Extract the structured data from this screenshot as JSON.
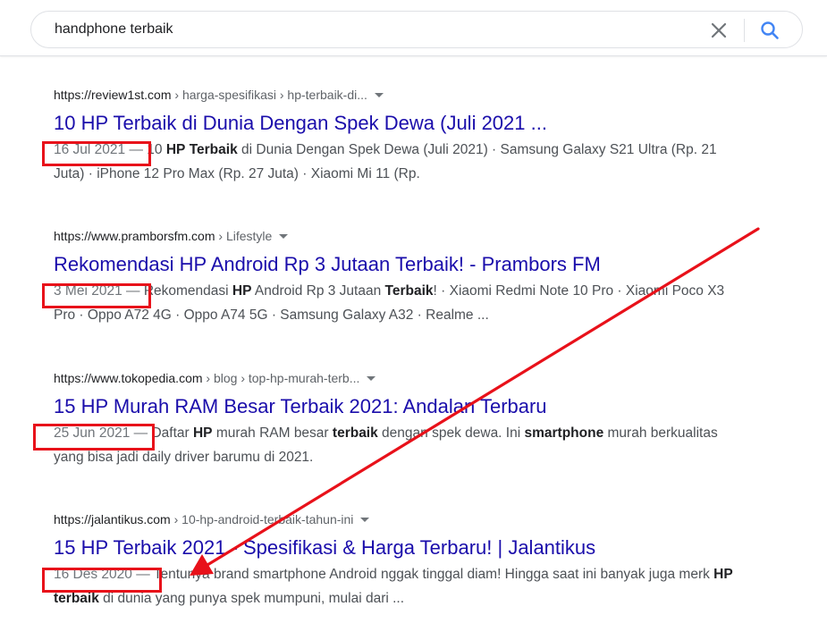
{
  "search": {
    "query": "handphone terbaik",
    "clear_icon": "close-icon",
    "search_icon": "search-icon"
  },
  "colors": {
    "link": "#1a0dab",
    "annotation": "#e8111a",
    "search_icon": "#4285f4"
  },
  "results": [
    {
      "domain": "https://review1st.com",
      "path": " › harga-spesifikasi › hp-terbaik-di...",
      "title": "10 HP Terbaik di Dunia Dengan Spek Dewa (Juli 2021 ...",
      "date": "16 Jul 2021",
      "dash": " — ",
      "snippet": [
        {
          "t": "10 ",
          "b": false
        },
        {
          "t": "HP",
          "b": true
        },
        {
          "t": " ",
          "b": false
        },
        {
          "t": "Terbaik",
          "b": true
        },
        {
          "t": " di Dunia Dengan Spek Dewa (Juli 2021) · Samsung Galaxy S21 Ultra (Rp. 21 Juta) · iPhone 12 Pro Max (Rp. 27 Juta) · Xiaomi Mi 11 (Rp.",
          "b": false
        }
      ]
    },
    {
      "domain": "https://www.pramborsfm.com",
      "path": " › Lifestyle",
      "title": "Rekomendasi HP Android Rp 3 Jutaan Terbaik! - Prambors FM",
      "date": "3 Mei 2021",
      "dash": " — ",
      "snippet": [
        {
          "t": "Rekomendasi ",
          "b": false
        },
        {
          "t": "HP",
          "b": true
        },
        {
          "t": " Android Rp 3 Jutaan ",
          "b": false
        },
        {
          "t": "Terbaik",
          "b": true
        },
        {
          "t": "! · Xiaomi Redmi Note 10 Pro · Xiaomi Poco X3 Pro · Oppo A72 4G · Oppo A74 5G · Samsung Galaxy A32 · Realme ...",
          "b": false
        }
      ]
    },
    {
      "domain": "https://www.tokopedia.com",
      "path": " › blog › top-hp-murah-terb...",
      "title": "15 HP Murah RAM Besar Terbaik 2021: Andalan Terbaru",
      "date": "25 Jun 2021",
      "dash": " — ",
      "snippet": [
        {
          "t": "Daftar ",
          "b": false
        },
        {
          "t": "HP",
          "b": true
        },
        {
          "t": " murah RAM besar ",
          "b": false
        },
        {
          "t": "terbaik",
          "b": true
        },
        {
          "t": " dengan spek dewa. Ini ",
          "b": false
        },
        {
          "t": "smartphone",
          "b": true
        },
        {
          "t": " murah berkualitas yang bisa jadi daily driver barumu di 2021.",
          "b": false
        }
      ]
    },
    {
      "domain": "https://jalantikus.com",
      "path": " › 10-hp-android-terbaik-tahun-ini",
      "title": "15 HP Terbaik 2021 - Spesifikasi & Harga Terbaru! | Jalantikus",
      "date": "16 Des 2020",
      "dash": " — ",
      "snippet": [
        {
          "t": "Tentunya brand smartphone Android nggak tinggal diam! Hingga saat ini banyak juga merk ",
          "b": false
        },
        {
          "t": "HP",
          "b": true
        },
        {
          "t": " ",
          "b": false
        },
        {
          "t": "terbaik",
          "b": true
        },
        {
          "t": " di dunia yang punya spek mumpuni, mulai dari ...",
          "b": false
        }
      ]
    }
  ]
}
